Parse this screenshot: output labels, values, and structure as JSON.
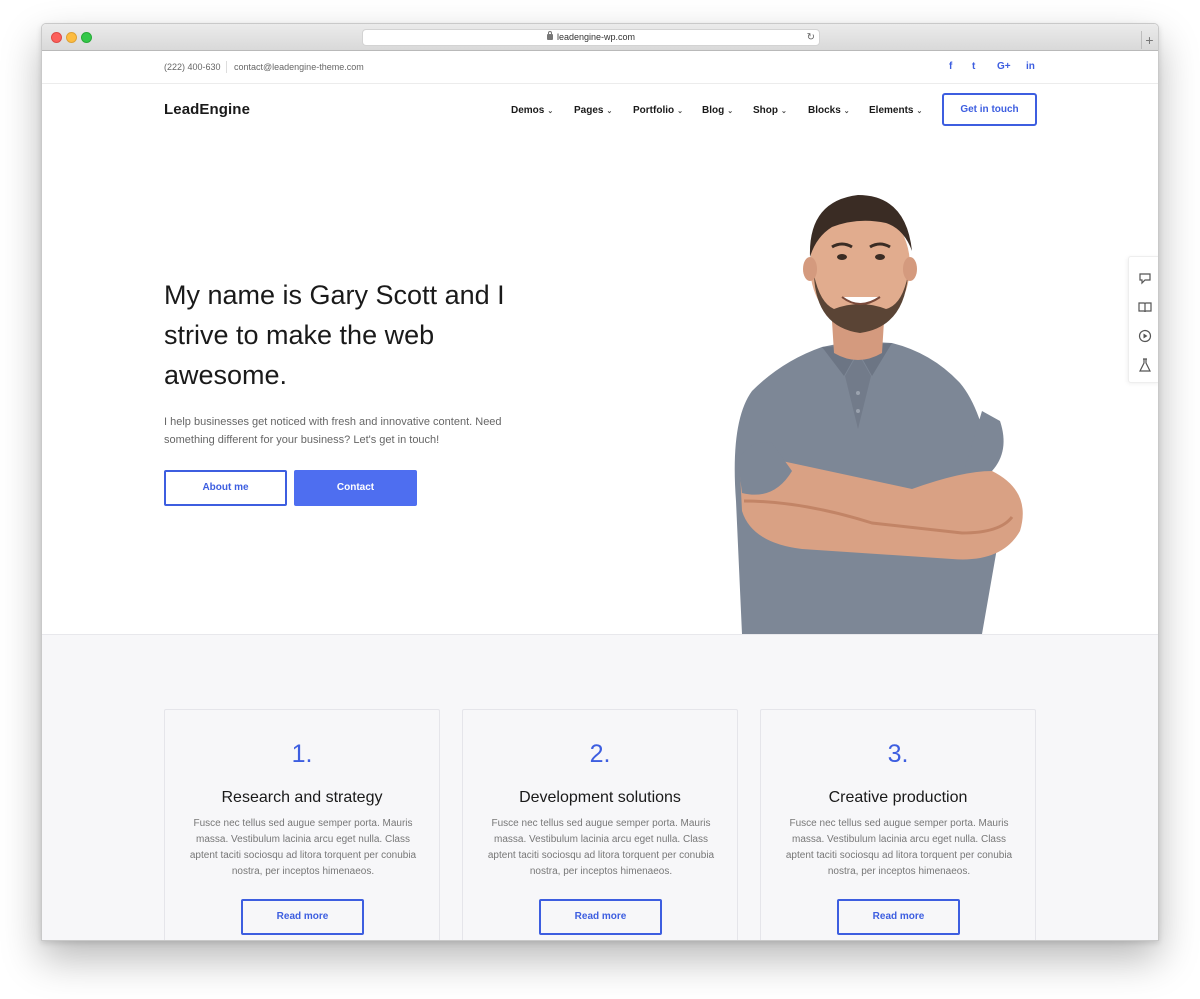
{
  "browser": {
    "url": "leadengine-wp.com"
  },
  "topbar": {
    "phone": "(222) 400-630",
    "email": "contact@leadengine-theme.com",
    "social": [
      "f",
      "t",
      "G+",
      "in"
    ]
  },
  "header": {
    "logo": "LeadEngine",
    "nav": [
      "Demos",
      "Pages",
      "Portfolio",
      "Blog",
      "Shop",
      "Blocks",
      "Elements"
    ],
    "cta": "Get in touch"
  },
  "hero": {
    "heading": "My name is Gary Scott and I strive to make the web awesome.",
    "text": "I help businesses get noticed with fresh and innovative content. Need something different for your business? Let's get in touch!",
    "primary_button": "About me",
    "secondary_button": "Contact"
  },
  "features": [
    {
      "number": "1.",
      "title": "Research and strategy",
      "text": "Fusce nec tellus sed augue semper porta. Mauris massa. Vestibulum lacinia arcu eget nulla. Class aptent taciti sociosqu ad litora torquent per conubia nostra, per inceptos himenaeos.",
      "button": "Read more"
    },
    {
      "number": "2.",
      "title": "Development solutions",
      "text": "Fusce nec tellus sed augue semper porta. Mauris massa. Vestibulum lacinia arcu eget nulla. Class aptent taciti sociosqu ad litora torquent per conubia nostra, per inceptos himenaeos.",
      "button": "Read more"
    },
    {
      "number": "3.",
      "title": "Creative production",
      "text": "Fusce nec tellus sed augue semper porta. Mauris massa. Vestibulum lacinia arcu eget nulla. Class aptent taciti sociosqu ad litora torquent per conubia nostra, per inceptos himenaeos.",
      "button": "Read more"
    }
  ],
  "side_panel_icons": [
    "chat-icon",
    "book-icon",
    "play-icon",
    "flask-icon"
  ],
  "colors": {
    "accent": "#3d5ee0",
    "button_fill": "#4e6ef0",
    "section_bg": "#f7f7f9"
  }
}
